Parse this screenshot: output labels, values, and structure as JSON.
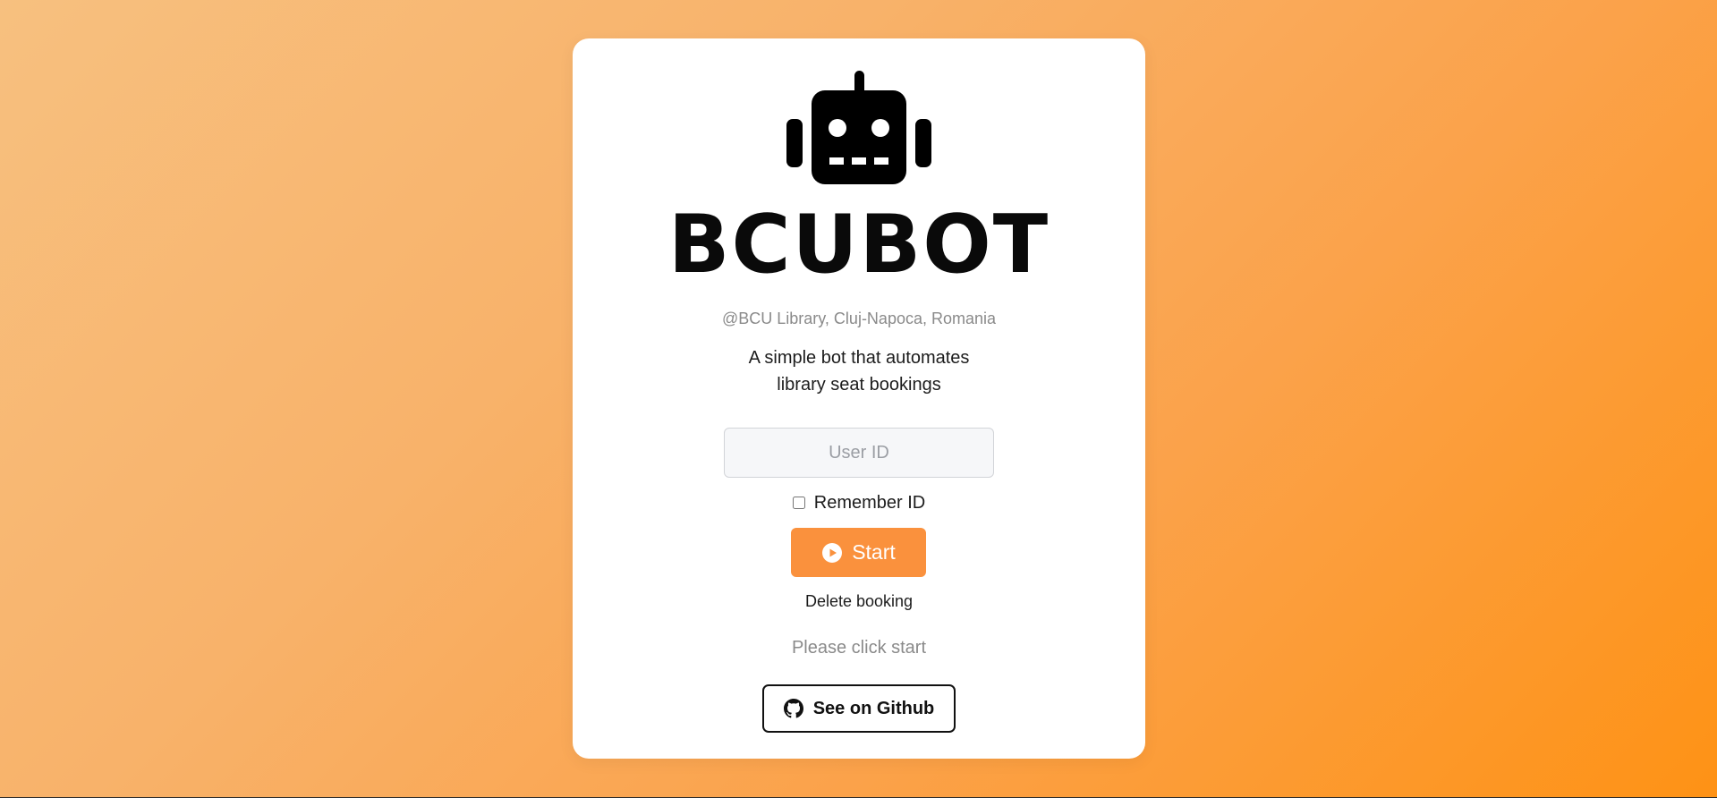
{
  "app": {
    "title": "BCUBOT",
    "location": "@BCU Library, Cluj-Napoca, Romania",
    "description": "A simple bot that automates library seat bookings"
  },
  "form": {
    "user_id_placeholder": "User ID",
    "user_id_value": "",
    "remember_label": "Remember ID",
    "remember_checked": false,
    "start_label": "Start",
    "delete_label": "Delete booking"
  },
  "status": {
    "message": "Please click start"
  },
  "footer": {
    "github_label": "See on Github"
  },
  "icons": {
    "logo": "robot-icon",
    "start": "play-circle-icon",
    "github": "github-icon"
  },
  "colors": {
    "accent": "#fa913d",
    "background_start": "#f7c07f",
    "background_end": "#fe9215",
    "card": "#ffffff",
    "text_primary": "#0a0a0a",
    "text_muted": "#8a8a8a"
  }
}
